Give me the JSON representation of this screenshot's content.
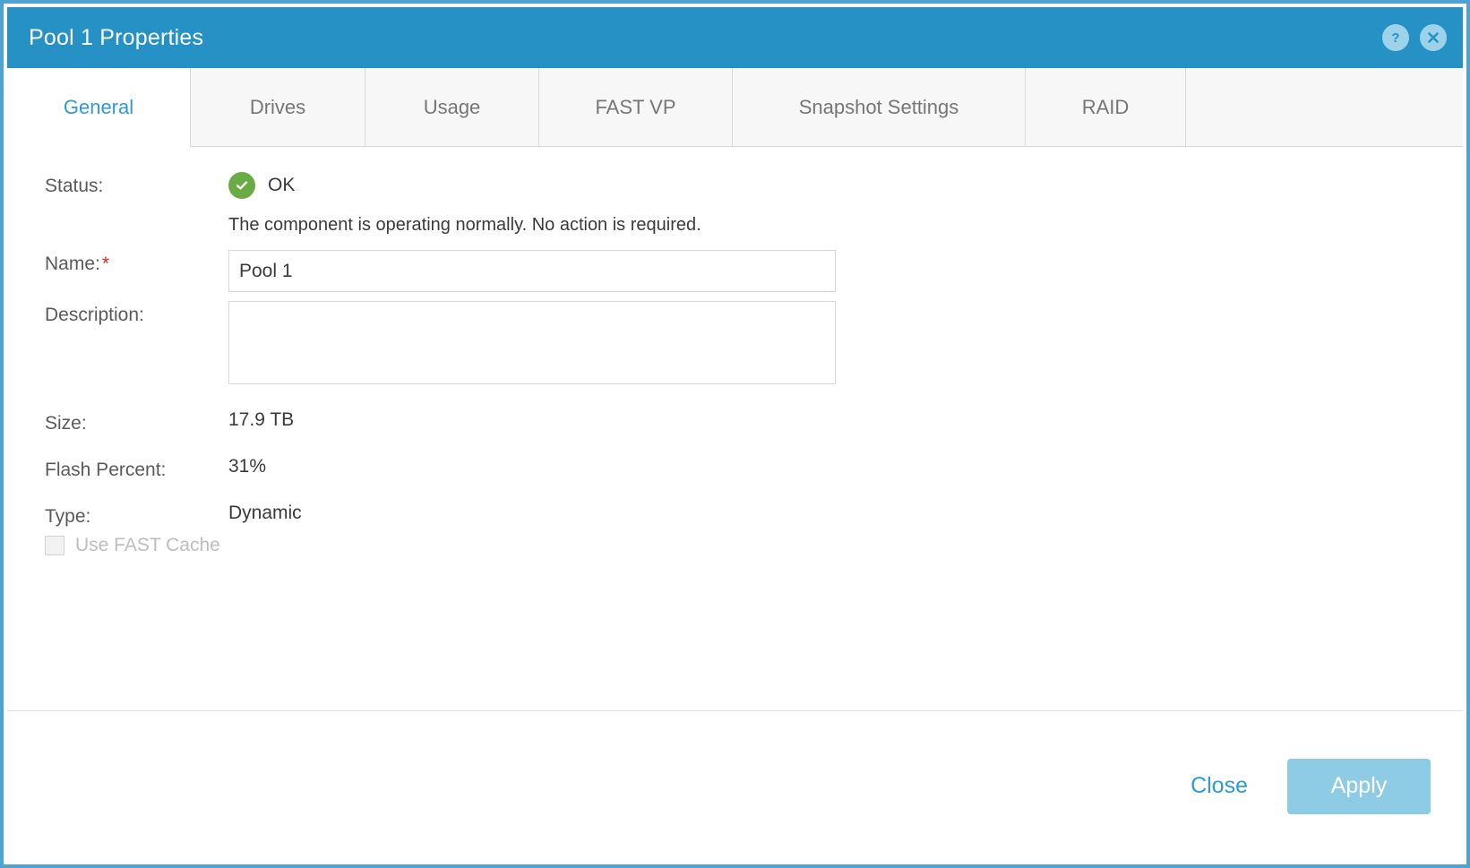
{
  "window": {
    "title": "Pool 1 Properties",
    "help_icon": "help-circle-icon",
    "close_icon": "close-circle-icon",
    "accent_color": "#2691c4",
    "border_color": "#4da3d4"
  },
  "tabs": [
    {
      "label": "General",
      "active": true
    },
    {
      "label": "Drives",
      "active": false
    },
    {
      "label": "Usage",
      "active": false
    },
    {
      "label": "FAST VP",
      "active": false
    },
    {
      "label": "Snapshot Settings",
      "active": false
    },
    {
      "label": "RAID",
      "active": false
    }
  ],
  "general": {
    "status_label": "Status:",
    "status_value": "OK",
    "status_icon": "check-circle-icon",
    "status_color": "#69ab44",
    "status_description": "The component is operating normally. No action is required.",
    "name_label": "Name:",
    "name_required_marker": "*",
    "name_value": "Pool 1",
    "name_placeholder": "",
    "description_label": "Description:",
    "description_value": "",
    "description_placeholder": "",
    "size_label": "Size:",
    "size_value": "17.9 TB",
    "flash_percent_label": "Flash Percent:",
    "flash_percent_value": "31%",
    "type_label": "Type:",
    "type_value": "Dynamic",
    "fast_cache_label": "Use FAST Cache",
    "fast_cache_checked": false,
    "fast_cache_enabled": false
  },
  "footer": {
    "close_label": "Close",
    "apply_label": "Apply",
    "apply_enabled": false
  }
}
